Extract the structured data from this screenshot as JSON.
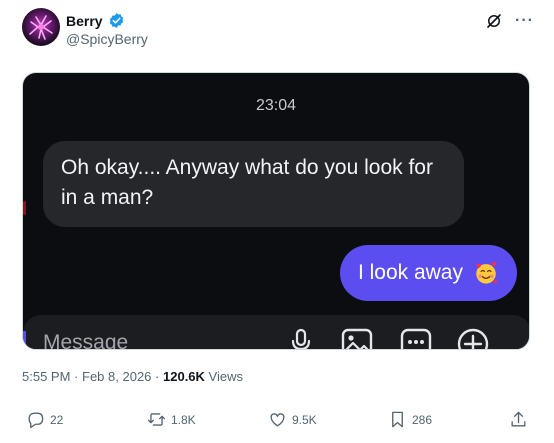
{
  "author": {
    "name": "Berry",
    "handle": "@SpicyBerry",
    "avatar": "avatar-icon"
  },
  "header_icons": {
    "grok": "grok-icon",
    "more": "···"
  },
  "media": {
    "chat_time": "23:04",
    "incoming_message": "Oh okay.... Anyway what do you look for in a man?",
    "outgoing_message": "I look away",
    "outgoing_emoji": "smiling-face-with-hearts-icon",
    "composer_placeholder": "Message",
    "composer_icons": [
      "microphone-icon",
      "image-icon",
      "more-options-icon",
      "plus-circle-icon"
    ]
  },
  "meta": {
    "time": "5:55 PM",
    "separator": "·",
    "date": "Feb 8, 2026",
    "views_count": "120.6K",
    "views_label": "Views"
  },
  "actions": {
    "replies": "22",
    "reposts": "1.8K",
    "likes": "9.5K",
    "bookmarks": "286"
  },
  "colors": {
    "verified": "#1d9bf0",
    "outgoing_bubble": "#5b4df0",
    "incoming_bubble": "#26272b",
    "chat_background": "#0c0d10",
    "secondary_text": "#536471"
  }
}
